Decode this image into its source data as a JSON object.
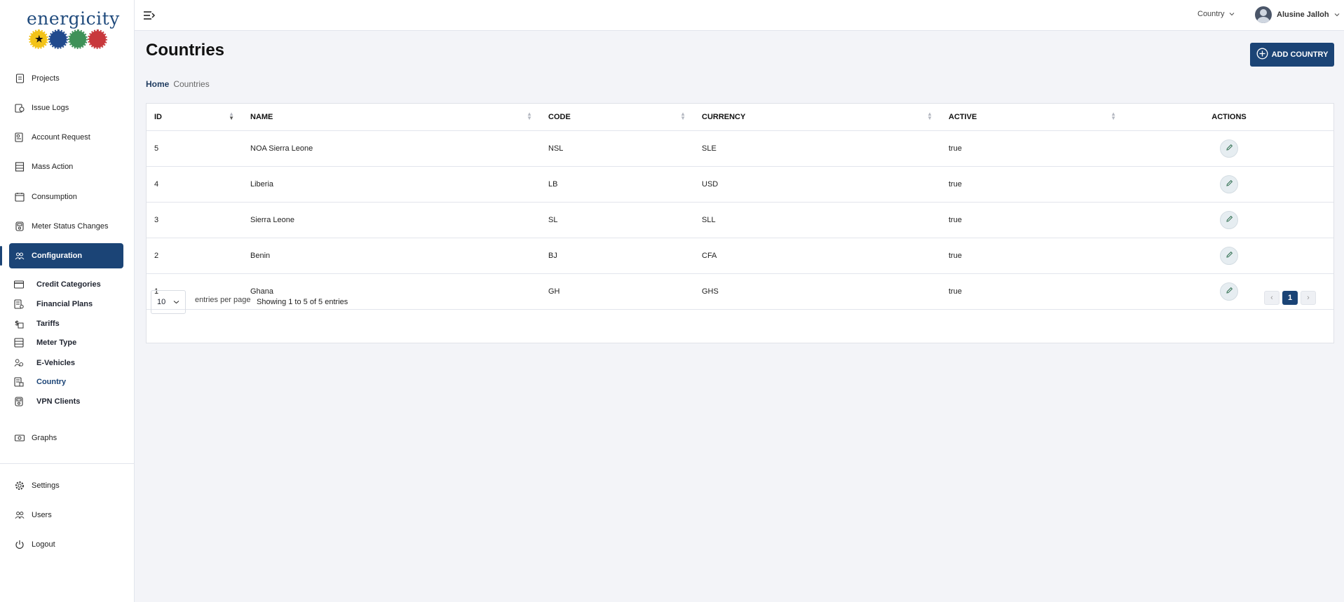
{
  "brand": {
    "name": "energicity"
  },
  "sidebar": {
    "items": [
      {
        "label": "Projects",
        "icon": "document-icon"
      },
      {
        "label": "Issue Logs",
        "icon": "log-icon"
      },
      {
        "label": "Account Request",
        "icon": "request-icon"
      },
      {
        "label": "Mass Action",
        "icon": "list-icon"
      },
      {
        "label": "Consumption",
        "icon": "calendar-icon"
      },
      {
        "label": "Meter Status Changes",
        "icon": "meter-icon"
      },
      {
        "label": "Configuration",
        "icon": "users-icon"
      }
    ],
    "config_subitems": [
      {
        "label": "Credit Categories",
        "icon": "card-icon"
      },
      {
        "label": "Financial Plans",
        "icon": "plan-icon"
      },
      {
        "label": "Tariffs",
        "icon": "tariff-icon"
      },
      {
        "label": "Meter Type",
        "icon": "meter-type-icon"
      },
      {
        "label": "E-Vehicles",
        "icon": "vehicle-icon"
      },
      {
        "label": "Country",
        "icon": "country-icon"
      },
      {
        "label": "VPN Clients",
        "icon": "vpn-icon"
      }
    ],
    "graphs": {
      "label": "Graphs",
      "icon": "graph-icon"
    },
    "bottom": [
      {
        "label": "Settings",
        "icon": "gear-icon"
      },
      {
        "label": "Users",
        "icon": "users-group-icon"
      },
      {
        "label": "Logout",
        "icon": "power-icon"
      }
    ]
  },
  "topbar": {
    "country_label": "Country",
    "user_name": "Alusine Jalloh"
  },
  "page": {
    "title": "Countries",
    "add_button": "ADD COUNTRY",
    "breadcrumb": {
      "home": "Home",
      "current": "Countries"
    }
  },
  "table": {
    "columns": [
      "ID",
      "NAME",
      "CODE",
      "CURRENCY",
      "ACTIVE",
      "ACTIONS"
    ],
    "rows": [
      {
        "id": "5",
        "name": "NOA Sierra Leone",
        "code": "NSL",
        "currency": "SLE",
        "active": "true"
      },
      {
        "id": "4",
        "name": "Liberia",
        "code": "LB",
        "currency": "USD",
        "active": "true"
      },
      {
        "id": "3",
        "name": "Sierra Leone",
        "code": "SL",
        "currency": "SLL",
        "active": "true"
      },
      {
        "id": "2",
        "name": "Benin",
        "code": "BJ",
        "currency": "CFA",
        "active": "true"
      },
      {
        "id": "1",
        "name": "Ghana",
        "code": "GH",
        "currency": "GHS",
        "active": "true"
      }
    ],
    "per_page_value": "10",
    "per_page_label": "entries per page",
    "showing": "Showing 1 to 5 of 5 entries",
    "pagination": {
      "prev": "‹",
      "current": "1",
      "next": "›"
    }
  },
  "colors": {
    "primary": "#1b4476",
    "background": "#f3f4f8"
  }
}
